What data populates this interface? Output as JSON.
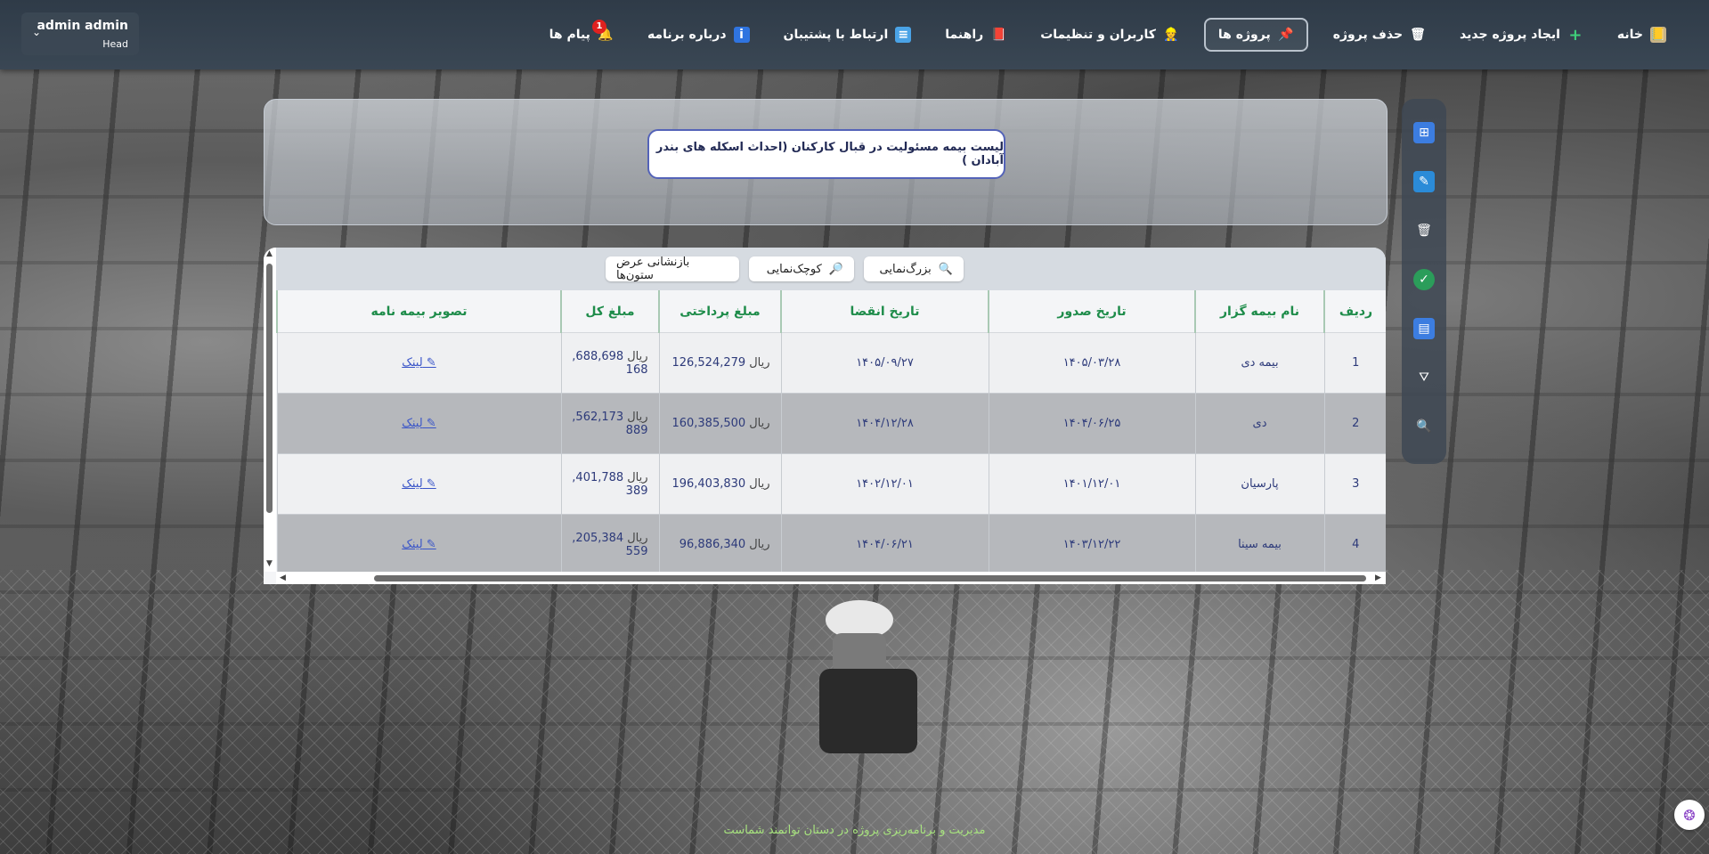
{
  "nav": {
    "items": [
      {
        "label": "خانه",
        "icon": "book-icon",
        "active": false
      },
      {
        "label": "ایجاد پروژه جدید",
        "icon": "plus-icon",
        "active": false
      },
      {
        "label": "حذف پروژه",
        "icon": "trash-icon",
        "active": false
      },
      {
        "label": "پروژه ها",
        "icon": "pin-icon",
        "active": true
      },
      {
        "label": "کاربران و تنظیمات",
        "icon": "user-icon",
        "active": false
      },
      {
        "label": "راهنما",
        "icon": "guide-book-icon",
        "active": false
      },
      {
        "label": "ارتباط با پشتیبان",
        "icon": "support-icon",
        "active": false
      },
      {
        "label": "درباره برنامه",
        "icon": "info-icon",
        "active": false
      },
      {
        "label": "پیام ها",
        "icon": "bell-icon",
        "active": false,
        "badge": "1"
      }
    ],
    "user": {
      "name": "admin admin",
      "role": "Head"
    }
  },
  "title": "لیست بیمه مسئولیت در قبال کارکنان (احداث اسکله های بندر آبادان )",
  "toolbar": {
    "zoom_in": "بزرگ‌نمایی",
    "zoom_out": "کوچک‌نمایی",
    "reset_widths": "بازنشانی عرض ستون‌ها"
  },
  "table": {
    "columns": [
      "ردیف",
      "نام بیمه گزار",
      "تاریخ صدور",
      "تاریخ انقضا",
      "مبلغ پرداختی",
      "مبلغ کل",
      "تصویر بیمه نامه"
    ],
    "currency": "ریال",
    "link_label": "لینک",
    "rows": [
      {
        "index": "1",
        "insurer": "بیمه دی",
        "issue": "۱۴۰۵/۰۳/۲۸",
        "expiry": "۱۴۰۵/۰۹/۲۷",
        "paid": "126,524,279",
        "total_a": "688,698,",
        "total_b": "168"
      },
      {
        "index": "2",
        "insurer": "دی",
        "issue": "۱۴۰۴/۰۶/۲۵",
        "expiry": "۱۴۰۴/۱۲/۲۸",
        "paid": "160,385,500",
        "total_a": "562,173,",
        "total_b": "889"
      },
      {
        "index": "3",
        "insurer": "پارسیان",
        "issue": "۱۴۰۱/۱۲/۰۱",
        "expiry": "۱۴۰۲/۱۲/۰۱",
        "paid": "196,403,830",
        "total_a": "401,788,",
        "total_b": "389"
      },
      {
        "index": "4",
        "insurer": "بیمه سینا",
        "issue": "۱۴۰۳/۱۲/۲۲",
        "expiry": "۱۴۰۴/۰۶/۲۱",
        "paid": "96,886,340",
        "total_a": "205,384,",
        "total_b": "559"
      }
    ]
  },
  "footer": "مدیریت و برنامه‌ریزی پروژه در دستان توانمند شماست"
}
